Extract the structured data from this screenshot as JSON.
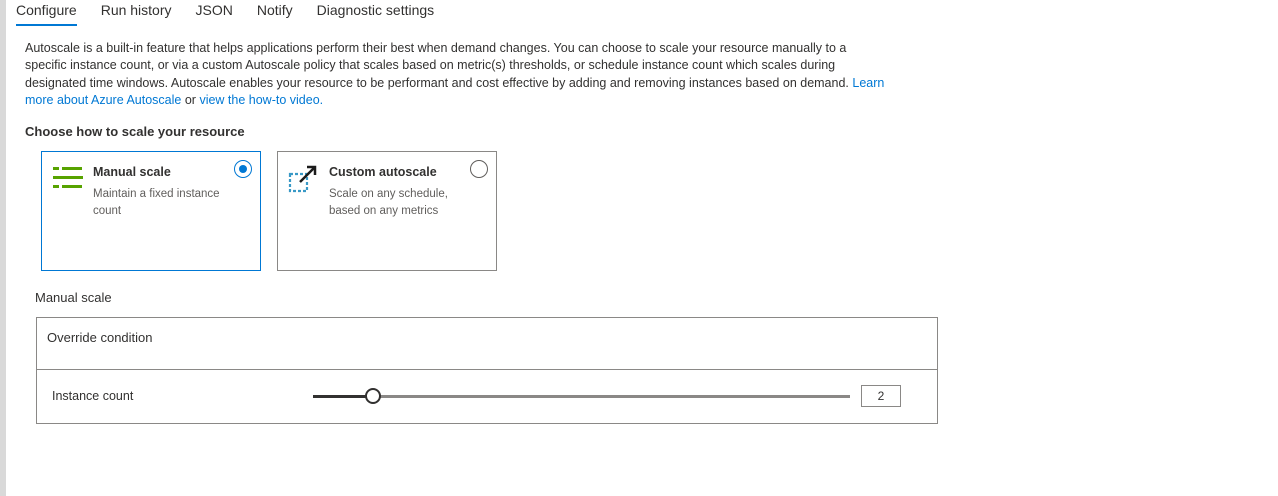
{
  "tabs": [
    {
      "label": "Configure",
      "active": true
    },
    {
      "label": "Run history",
      "active": false
    },
    {
      "label": "JSON",
      "active": false
    },
    {
      "label": "Notify",
      "active": false
    },
    {
      "label": "Diagnostic settings",
      "active": false
    }
  ],
  "description": {
    "text": "Autoscale is a built-in feature that helps applications perform their best when demand changes. You can choose to scale your resource manually to a specific instance count, or via a custom Autoscale policy that scales based on metric(s) thresholds, or schedule instance count which scales during designated time windows. Autoscale enables your resource to be performant and cost effective by adding and removing instances based on demand.",
    "link_learn_more": "Learn more about Azure Autoscale",
    "connector": "or",
    "link_video": "view the how-to video."
  },
  "section_title": "Choose how to scale your resource",
  "options": {
    "manual": {
      "title": "Manual scale",
      "description": "Maintain a fixed instance count",
      "selected": true
    },
    "custom": {
      "title": "Custom autoscale",
      "description": "Scale on any schedule, based on any metrics",
      "selected": false
    }
  },
  "manual_scale": {
    "heading": "Manual scale",
    "override_label": "Override condition",
    "instance_count_label": "Instance count",
    "instance_count_value": "2",
    "slider_fraction": 0.112
  },
  "colors": {
    "accent": "#0078d4",
    "manual_icon_green": "#57a300",
    "custom_icon_blue": "#3999c6"
  }
}
